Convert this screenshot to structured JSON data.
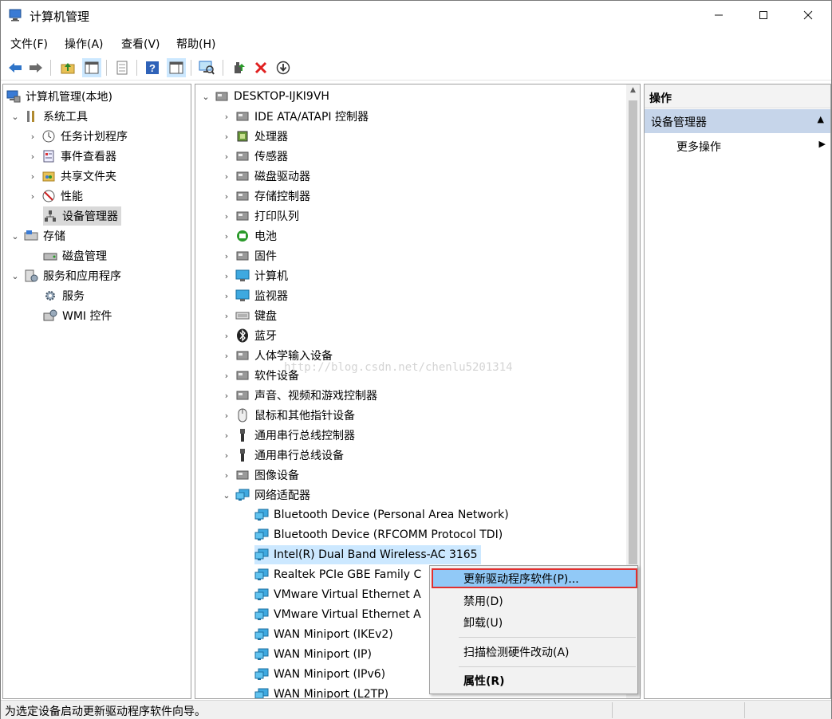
{
  "window": {
    "title": "计算机管理"
  },
  "menu": [
    "文件(F)",
    "操作(A)",
    "查看(V)",
    "帮助(H)"
  ],
  "left_tree": {
    "root": "计算机管理(本地)",
    "system_tools": "系统工具",
    "system_items": [
      "任务计划程序",
      "事件查看器",
      "共享文件夹",
      "性能",
      "设备管理器"
    ],
    "storage": "存储",
    "storage_items": [
      "磁盘管理"
    ],
    "services": "服务和应用程序",
    "services_items": [
      "服务",
      "WMI 控件"
    ]
  },
  "device_tree": {
    "root": "DESKTOP-IJKI9VH",
    "categories": [
      "IDE ATA/ATAPI 控制器",
      "处理器",
      "传感器",
      "磁盘驱动器",
      "存储控制器",
      "打印队列",
      "电池",
      "固件",
      "计算机",
      "监视器",
      "键盘",
      "蓝牙",
      "人体学输入设备",
      "软件设备",
      "声音、视频和游戏控制器",
      "鼠标和其他指针设备",
      "通用串行总线控制器",
      "通用串行总线设备",
      "图像设备",
      "网络适配器"
    ],
    "network_adapters": [
      "Bluetooth Device (Personal Area Network)",
      "Bluetooth Device (RFCOMM Protocol TDI)",
      "Intel(R) Dual Band Wireless-AC 3165",
      "Realtek PCIe GBE Family C",
      "VMware Virtual Ethernet A",
      "VMware Virtual Ethernet A",
      "WAN Miniport (IKEv2)",
      "WAN Miniport (IP)",
      "WAN Miniport (IPv6)",
      "WAN Miniport (L2TP)"
    ]
  },
  "actions": {
    "header": "操作",
    "group": "设备管理器",
    "more": "更多操作"
  },
  "context_menu": {
    "update": "更新驱动程序软件(P)...",
    "disable": "禁用(D)",
    "uninstall": "卸载(U)",
    "scan": "扫描检测硬件改动(A)",
    "properties": "属性(R)"
  },
  "watermark": "http://blog.csdn.net/chenlu5201314",
  "status": "为选定设备启动更新驱动程序软件向导。",
  "colors": {
    "selection_blue": "#cce8ff",
    "context_highlight": "#91c9f7",
    "callout_red": "#e03030",
    "action_group": "#c6d5ea"
  }
}
